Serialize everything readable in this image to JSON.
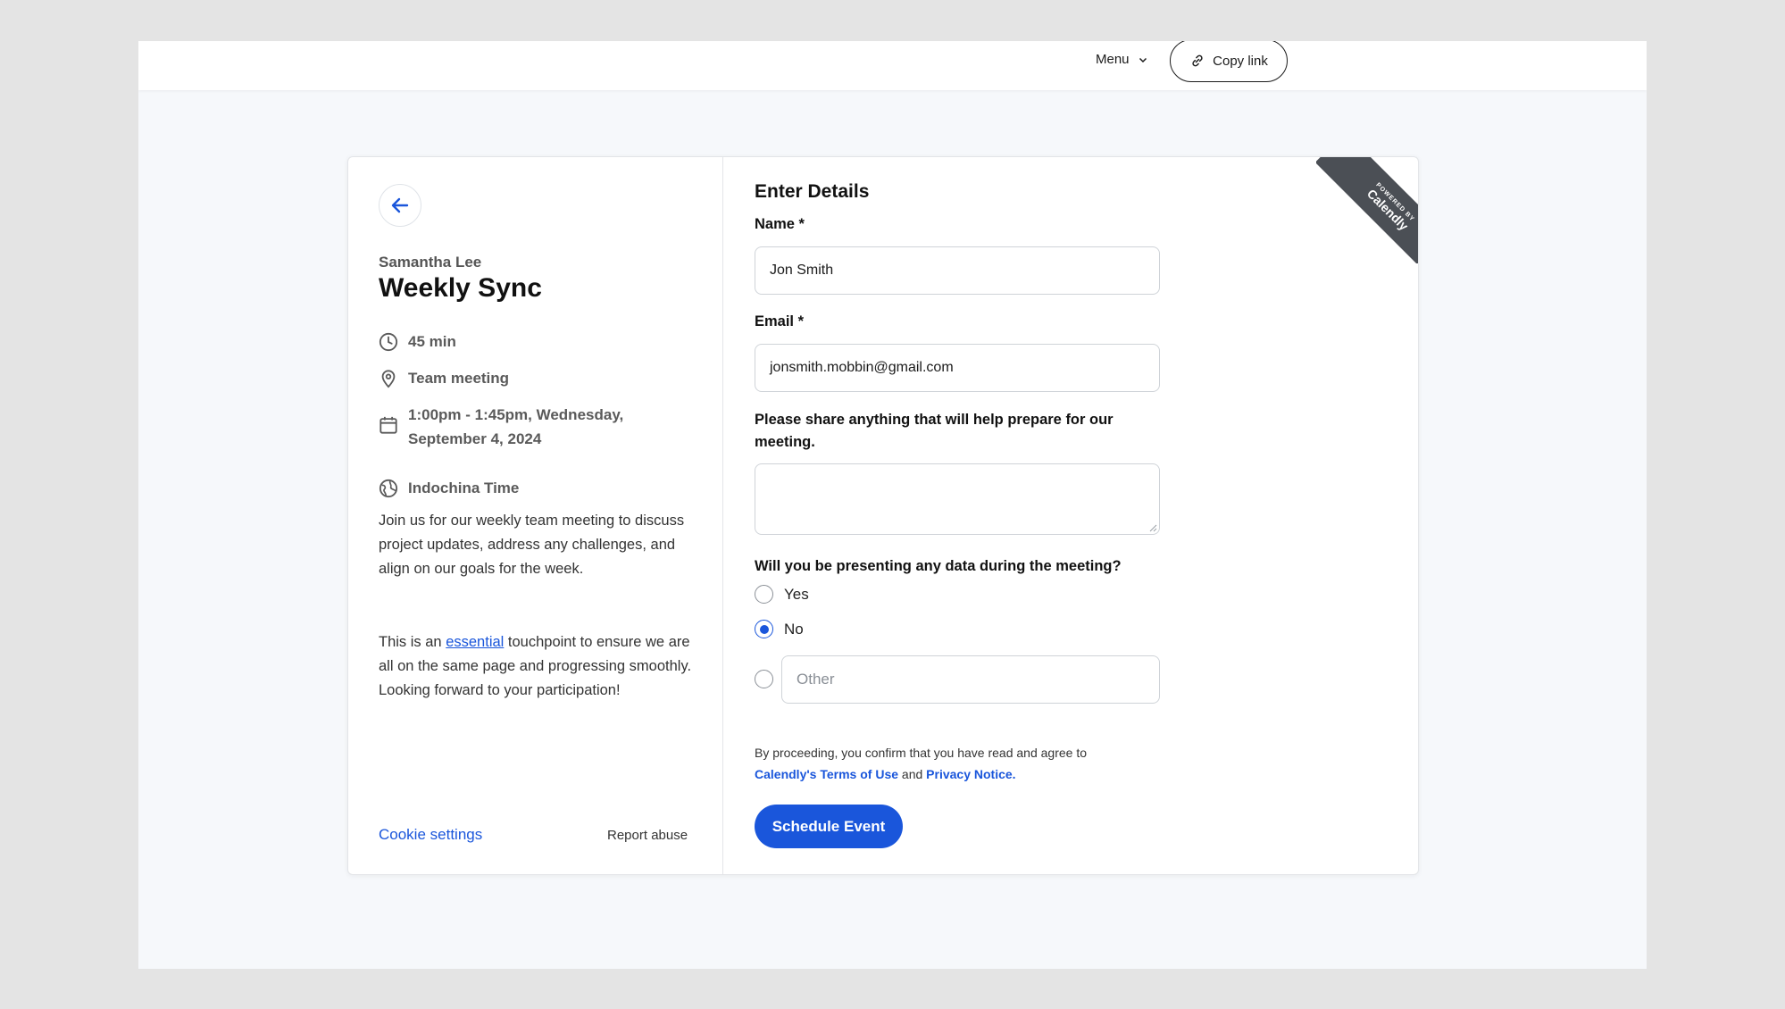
{
  "topbar": {
    "menu_label": "Menu",
    "copy_link_label": "Copy link"
  },
  "event": {
    "organizer": "Samantha Lee",
    "title": "Weekly Sync",
    "duration": "45 min",
    "location": "Team meeting",
    "datetime_line1": "1:00pm - 1:45pm, Wednesday,",
    "datetime_line2": "September 4, 2024",
    "timezone": "Indochina Time",
    "description_1": "Join us for our weekly team meeting to discuss project updates, address any challenges, and align on our goals for the week.",
    "description_2_before": "This is an ",
    "description_2_link": "essential",
    "description_2_after": " touchpoint to ensure we are all on the same page and progressing smoothly. Looking forward to your participation!"
  },
  "footer": {
    "cookie_settings": "Cookie settings",
    "report_abuse": "Report abuse"
  },
  "form": {
    "section_title": "Enter Details",
    "name_label": "Name *",
    "name_value": "Jon Smith",
    "email_label": "Email *",
    "email_value": "jonsmith.mobbin@gmail.com",
    "notes_label": "Please share anything that will help prepare for our meeting.",
    "question_label": "Will you be presenting any data during the meeting?",
    "options": [
      {
        "label": "Yes",
        "selected": false
      },
      {
        "label": "No",
        "selected": true
      }
    ],
    "other_placeholder": "Other",
    "legal_text": "By proceeding, you confirm that you have read and agree to",
    "terms_link": "Calendly's Terms of Use",
    "and_text": "and",
    "privacy_link": "Privacy Notice.",
    "submit_label": "Schedule Event"
  },
  "badge": {
    "powered_by": "POWERED BY",
    "brand": "Calendly"
  },
  "colors": {
    "accent": "#1a56db",
    "ribbon": "#4b4f55"
  }
}
